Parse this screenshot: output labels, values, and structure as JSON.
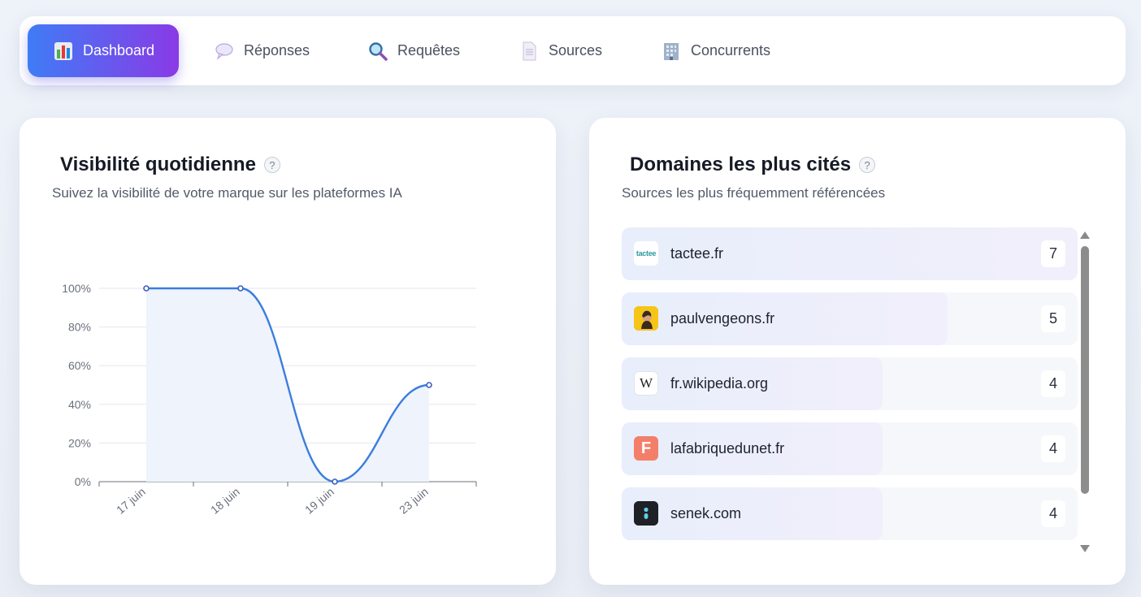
{
  "nav": {
    "items": [
      {
        "label": "Dashboard",
        "icon": "bar-chart-icon",
        "active": true
      },
      {
        "label": "Réponses",
        "icon": "speech-bubble-icon",
        "active": false
      },
      {
        "label": "Requêtes",
        "icon": "magnifier-icon",
        "active": false
      },
      {
        "label": "Sources",
        "icon": "document-icon",
        "active": false
      },
      {
        "label": "Concurrents",
        "icon": "office-building-icon",
        "active": false
      }
    ]
  },
  "visibility": {
    "title": "Visibilité quotidienne",
    "help": "?",
    "subtitle": "Suivez la visibilité de votre marque sur les plateformes IA"
  },
  "chart_data": {
    "type": "line",
    "categories": [
      "17 juin",
      "18 juin",
      "19 juin",
      "23 juin"
    ],
    "values": [
      100,
      100,
      0,
      50
    ],
    "yticks": [
      "0%",
      "20%",
      "40%",
      "60%",
      "80%",
      "100%"
    ],
    "ylim": [
      0,
      100
    ],
    "xlabel": "",
    "ylabel": "",
    "grid": true,
    "colors": {
      "line": "#3b7ddd",
      "area": "#eef3fc"
    }
  },
  "domains": {
    "title": "Domaines les plus cités",
    "help": "?",
    "subtitle": "Sources les plus fréquemment référencées",
    "max": 7,
    "items": [
      {
        "name": "tactee.fr",
        "count": 7,
        "logo_text": "tactee",
        "logo_color": "#2b9aa0",
        "logo_bg": "#ffffff"
      },
      {
        "name": "paulvengeons.fr",
        "count": 5,
        "logo_text": "",
        "logo_color": "#333333",
        "logo_bg": "#f5c518"
      },
      {
        "name": "fr.wikipedia.org",
        "count": 4,
        "logo_text": "W",
        "logo_color": "#222222",
        "logo_bg": "#ffffff"
      },
      {
        "name": "lafabriquedunet.fr",
        "count": 4,
        "logo_text": "F",
        "logo_color": "#ffffff",
        "logo_bg": "#f37f6a"
      },
      {
        "name": "senek.com",
        "count": 4,
        "logo_text": "",
        "logo_color": "#5fd0e6",
        "logo_bg": "#1f2126"
      }
    ]
  }
}
